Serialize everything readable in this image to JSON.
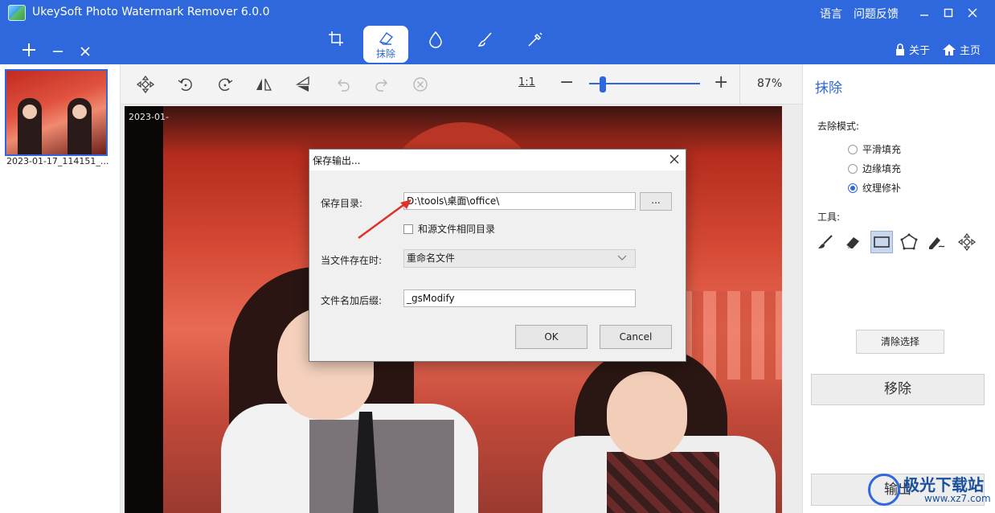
{
  "app": {
    "title": "UkeySoft Photo Watermark Remover 6.0.0",
    "links": [
      "语言",
      "问题反馈"
    ],
    "about": "关于",
    "home": "主页",
    "accent": "#2f68dc"
  },
  "mode_tabs": [
    {
      "icon": "crop-icon",
      "label": ""
    },
    {
      "icon": "eraser-icon",
      "label": "抹除"
    },
    {
      "icon": "drop-icon",
      "label": ""
    },
    {
      "icon": "brush-icon",
      "label": ""
    },
    {
      "icon": "magic-wand-icon",
      "label": ""
    }
  ],
  "file_actions": [
    "add-icon",
    "minus-icon",
    "close-icon"
  ],
  "thumbnail": {
    "caption": "2023-01-17_114151_..."
  },
  "toolbar": {
    "icons": [
      "move-icon",
      "rotate-left-icon",
      "rotate-right-icon",
      "flip-horizontal-icon",
      "flip-vertical-icon",
      "undo-icon",
      "redo-icon",
      "clear-icon"
    ],
    "one_to_one": "1:1",
    "zoom_minus": "−",
    "zoom_plus": "+",
    "zoom_level": 0.12,
    "zoom_percent": "87%"
  },
  "photo": {
    "date_text": "2023-01-"
  },
  "right_panel": {
    "title": "抹除",
    "mode_label": "去除模式:",
    "modes": [
      {
        "label": "平滑填充",
        "checked": false
      },
      {
        "label": "边缘填充",
        "checked": false
      },
      {
        "label": "纹理修补",
        "checked": true
      }
    ],
    "tools_label": "工具:",
    "tools": [
      "brush-icon",
      "eraser-icon",
      "rectangle-select-icon",
      "polygon-select-icon",
      "pen-icon",
      "move-icon"
    ],
    "active_tool": 2,
    "clear_selection": "清除选择",
    "remove": "移除",
    "export": "输出"
  },
  "dialog": {
    "title": "保存输出...",
    "save_dir_label": "保存目录:",
    "save_dir_value": "D:\\tools\\桌面\\office\\",
    "browse": "...",
    "same_dir_label": "和源文件相同目录",
    "same_dir_checked": false,
    "exists_label": "当文件存在时:",
    "exists_value": "重命名文件",
    "suffix_label": "文件名加后缀:",
    "suffix_value": "_gsModify",
    "ok": "OK",
    "cancel": "Cancel"
  },
  "watermark": {
    "main": "极光下载站",
    "sub": "www.xz7.com"
  }
}
